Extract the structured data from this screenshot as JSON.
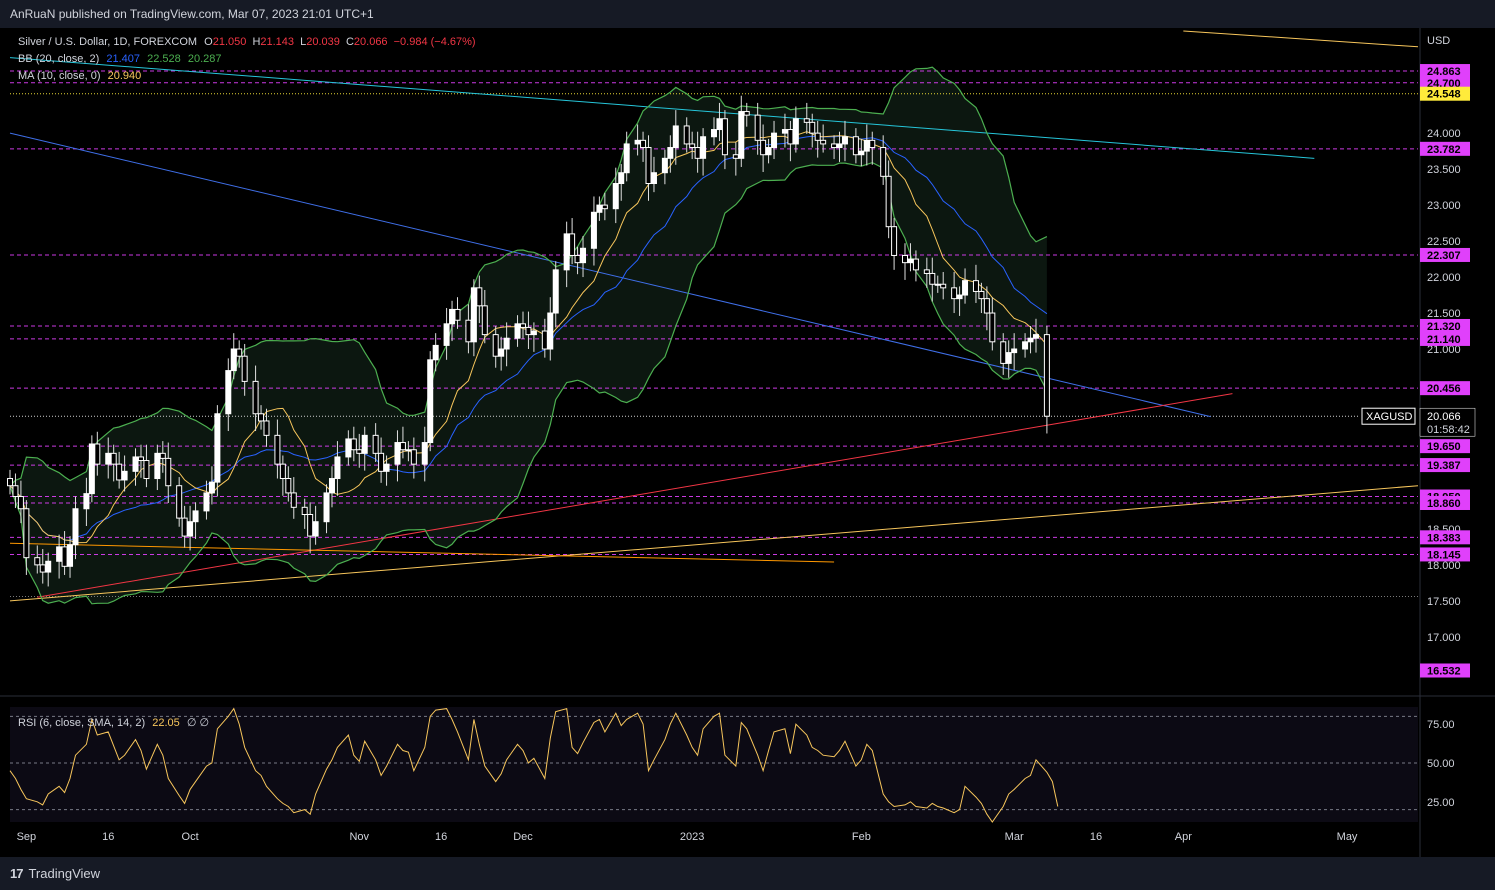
{
  "header": {
    "text": "AnRuaN published on TradingView.com, Mar 07, 2023 21:01 UTC+1"
  },
  "footer": {
    "logo_text": "TradingView",
    "logo_glyph": "17"
  },
  "legend": {
    "symbol": "Silver / U.S. Dollar, 1D, FOREXCOM",
    "open_label": "O",
    "open": "21.050",
    "high_label": "H",
    "high": "21.143",
    "low_label": "L",
    "low": "20.039",
    "close_label": "C",
    "close": "20.066",
    "change": "−0.984 (−4.67%)",
    "bb_label": "BB (20, close, 2)",
    "bb_basis": "21.407",
    "bb_upper": "22.528",
    "bb_lower": "20.287",
    "ma_label": "MA (10, close, 0)",
    "ma_value": "20.940",
    "rsi_label": "RSI (6, close, SMA, 14, 2)",
    "rsi_value": "22.05",
    "rsi_extra": "∅ ∅"
  },
  "colors": {
    "up": "#ffffff",
    "down": "#ffffff",
    "bb_band": "#4caf50",
    "bb_basis": "#2962ff",
    "ma": "#f7c65c",
    "rsi": "#f7c65c",
    "level": "#e040fb",
    "cyan_trend": "#26c6da",
    "blue_trend": "#3f6fe8",
    "red_trend": "#f23645",
    "yellow_trend": "#f7c65c",
    "orange_trend": "#ff9800",
    "label_bg": "#e040fb",
    "label_yellow_bg": "#ffeb3b"
  },
  "chart_data": [
    {
      "type": "candlestick",
      "title": "Silver / U.S. Dollar, 1D, FOREXCOM",
      "currency": "USD",
      "ylim": [
        16.4,
        25.35
      ],
      "y_ticks": [
        "24.000",
        "23.500",
        "23.000",
        "22.500",
        "22.000",
        "21.500",
        "21.000",
        "18.500",
        "18.000",
        "17.500",
        "17.000"
      ],
      "x_ticks": [
        "Sep",
        "16",
        "Oct",
        "Nov",
        "16",
        "Dec",
        "2023",
        "Feb",
        "Mar",
        "16",
        "Apr",
        "May"
      ],
      "x_tick_dates": [
        "2022-09-01",
        "2022-09-16",
        "2022-10-01",
        "2022-11-01",
        "2022-11-16",
        "2022-12-01",
        "2023-01-01",
        "2023-02-01",
        "2023-03-01",
        "2023-03-16",
        "2023-04-01",
        "2023-05-01"
      ],
      "date_range": [
        "2022-08-29",
        "2023-05-14"
      ],
      "horizontal_levels": [
        {
          "value": 24.863,
          "label": "24.863",
          "style": "dashed",
          "color": "#e040fb"
        },
        {
          "value": 24.7,
          "label": "24.700",
          "style": "dashed",
          "color": "#e040fb"
        },
        {
          "value": 24.548,
          "label": "24.548",
          "style": "dotted",
          "color": "#ffeb3b"
        },
        {
          "value": 23.782,
          "label": "23.782",
          "style": "dashed",
          "color": "#e040fb"
        },
        {
          "value": 22.307,
          "label": "22.307",
          "style": "dashed",
          "color": "#e040fb"
        },
        {
          "value": 21.32,
          "label": "21.320",
          "style": "dashed",
          "color": "#e040fb"
        },
        {
          "value": 21.14,
          "label": "21.140",
          "style": "dashed",
          "color": "#e040fb"
        },
        {
          "value": 20.456,
          "label": "20.456",
          "style": "dashed",
          "color": "#e040fb"
        },
        {
          "value": 19.65,
          "label": "19.650",
          "style": "dashed",
          "color": "#e040fb"
        },
        {
          "value": 19.387,
          "label": "19.387",
          "style": "dashed",
          "color": "#e040fb"
        },
        {
          "value": 18.95,
          "label": "18.950",
          "style": "dashed",
          "color": "#e040fb"
        },
        {
          "value": 18.86,
          "label": "18.860",
          "style": "dashed",
          "color": "#e040fb"
        },
        {
          "value": 18.383,
          "label": "18.383",
          "style": "dashed",
          "color": "#e040fb"
        },
        {
          "value": 18.145,
          "label": "18.145",
          "style": "dashed",
          "color": "#e040fb"
        },
        {
          "value": 17.56,
          "label": "",
          "style": "dotted",
          "color": "#888888"
        },
        {
          "value": 16.532,
          "label": "16.532",
          "style": "none",
          "color": "#e040fb"
        }
      ],
      "last_price": {
        "symbol": "XAGUSD",
        "value": 20.066,
        "label": "20.066",
        "countdown": "01:58:42"
      },
      "trendlines": [
        {
          "name": "cyan",
          "color": "#26c6da",
          "points": [
            [
              "2022-08-29",
              25.05
            ],
            [
              "2023-04-25",
              23.65
            ]
          ]
        },
        {
          "name": "blue",
          "color": "#3f6fe8",
          "points": [
            [
              "2022-08-29",
              24.0
            ],
            [
              "2023-04-06",
              20.06
            ]
          ]
        },
        {
          "name": "red",
          "color": "#f23645",
          "points": [
            [
              "2022-09-03",
              17.55
            ],
            [
              "2023-04-10",
              20.38
            ]
          ]
        },
        {
          "name": "yellow-lower",
          "color": "#f7c65c",
          "points": [
            [
              "2022-08-29",
              17.5
            ],
            [
              "2023-05-14",
              19.1
            ]
          ]
        },
        {
          "name": "yellow-upper",
          "color": "#f7c65c",
          "points": [
            [
              "2023-04-01",
              25.42
            ],
            [
              "2023-05-14",
              25.2
            ]
          ]
        },
        {
          "name": "orange",
          "color": "#ff9800",
          "points": [
            [
              "2022-08-29",
              18.3
            ],
            [
              "2023-01-27",
              18.04
            ]
          ]
        }
      ],
      "candles_close": [
        [
          19.1,
          18.95,
          18.78,
          18.1,
          18.0,
          17.9,
          18.05,
          18.25,
          17.98,
          18.28,
          18.78,
          18.99,
          19.68,
          19.4,
          19.55,
          19.4,
          19.18,
          19.3,
          19.5,
          19.45,
          19.2,
          19.55,
          19.48,
          19.1,
          18.65,
          18.4,
          18.6,
          18.75,
          19.0,
          19.15,
          20.1,
          20.7,
          21.0,
          20.9,
          20.55,
          20.1,
          20.0,
          19.8,
          19.4,
          19.2,
          19.0,
          18.8,
          18.7,
          18.4,
          18.6,
          19.0,
          19.2,
          19.5,
          19.75,
          19.6,
          19.55,
          19.8,
          19.55,
          19.3,
          19.4,
          19.7,
          19.6,
          19.6,
          19.4,
          19.7,
          20.85,
          21.05,
          21.35,
          21.55,
          21.4,
          21.1,
          21.85,
          21.6,
          21.2,
          20.9,
          21.0,
          21.15,
          21.35,
          21.3,
          21.2,
          21.25,
          21.0,
          21.5,
          22.1,
          22.6,
          22.3,
          22.2,
          22.4,
          22.9,
          23.0,
          22.95,
          23.3,
          23.45,
          23.85,
          23.9,
          23.8,
          23.3,
          23.45,
          23.65,
          23.8,
          24.1,
          23.85,
          23.8,
          23.65,
          23.95,
          24.05,
          24.2,
          23.7,
          23.65,
          24.3,
          24.25,
          23.9,
          23.7,
          23.8,
          24.0,
          24.05,
          23.85,
          24.2,
          24.15,
          24.0,
          23.9,
          23.85,
          23.8,
          23.85,
          23.95,
          23.7,
          23.75,
          23.9,
          23.8,
          23.4,
          22.7,
          22.3,
          22.2,
          22.25,
          22.1,
          22.05,
          21.9,
          21.9,
          21.85,
          21.7,
          21.75,
          21.95,
          21.8,
          21.7,
          21.5,
          21.1,
          20.8,
          20.95,
          21.0,
          21.1,
          21.15,
          21.2,
          20.066
        ]
      ]
    },
    {
      "type": "line",
      "title": "RSI (6, close, SMA, 14, 2)",
      "ylim": [
        12,
        86
      ],
      "y_ticks": [
        "75.00",
        "50.00",
        "25.00"
      ],
      "levels": [
        80,
        50,
        20
      ],
      "series": [
        {
          "name": "RSI",
          "values": [
            45,
            40,
            33,
            27,
            25,
            23,
            30,
            35,
            31,
            40,
            55,
            62,
            78,
            68,
            70,
            61,
            52,
            55,
            65,
            58,
            46,
            62,
            55,
            40,
            29,
            24,
            33,
            38,
            48,
            50,
            72,
            80,
            85,
            75,
            60,
            45,
            42,
            35,
            27,
            24,
            22,
            18,
            20,
            17,
            30,
            46,
            52,
            60,
            68,
            55,
            51,
            64,
            52,
            42,
            48,
            62,
            58,
            57,
            45,
            60,
            80,
            84,
            85,
            78,
            70,
            52,
            78,
            62,
            48,
            38,
            43,
            52,
            62,
            58,
            50,
            53,
            40,
            66,
            83,
            85,
            60,
            56,
            63,
            76,
            78,
            70,
            82,
            74,
            78,
            82,
            75,
            45,
            52,
            65,
            75,
            82,
            68,
            60,
            55,
            72,
            80,
            82,
            55,
            48,
            76,
            72,
            55,
            45,
            58,
            70,
            72,
            56,
            75,
            68,
            60,
            58,
            55,
            54,
            58,
            64,
            48,
            52,
            62,
            58,
            30,
            25,
            22,
            23,
            25,
            22,
            21,
            24,
            22,
            21,
            18,
            20,
            35,
            28,
            24,
            17,
            12,
            22,
            30,
            33,
            40,
            42,
            52,
            44,
            38,
            22
          ]
        }
      ]
    }
  ]
}
